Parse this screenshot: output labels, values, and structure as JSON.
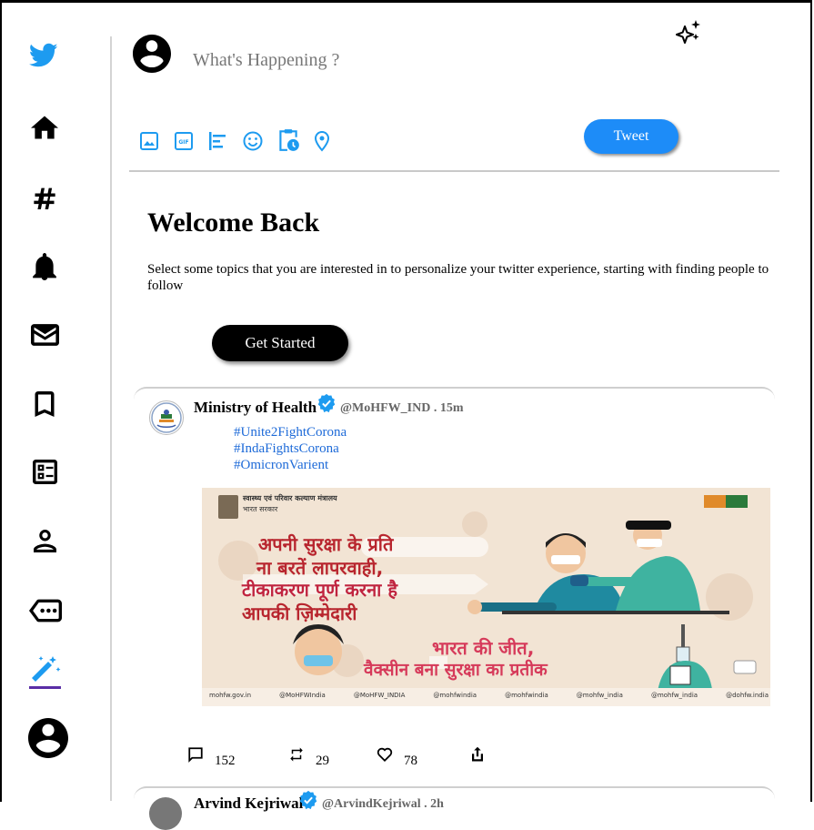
{
  "compose": {
    "placeholder": "What's Happening ?",
    "tweet_label": "Tweet"
  },
  "welcome": {
    "title": "Welcome Back",
    "text": "Select some topics that you are interested in to personalize your twitter experience, starting with finding people to follow",
    "button_label": "Get Started"
  },
  "posts": [
    {
      "name": "Ministry of Health",
      "handle": "@MoHFW_IND . 15m",
      "verified": true,
      "hashtags": [
        "#Unite2FightCorona",
        "#IndaFightsCorona",
        "#OmicronVarient"
      ],
      "image": {
        "header_line1": "स्वास्थ्य एवं परिवार कल्याण मंत्रालय",
        "header_line2": "भारत सरकार",
        "line1": "अपनी सुरक्षा के प्रति",
        "line2": "ना बरतें लापरवाही,",
        "line3": "टीकाकरण पूर्ण करना है",
        "line4": "आपकी ज़िम्मेदारी",
        "line5": "भारत की जीत,",
        "line6": "वैक्सीन बना सुरक्षा का प्रतीक",
        "footer": [
          "mohfw.gov.in",
          "@MoHFWIndia",
          "@MoHFW_INDIA",
          "@mohfwindia",
          "@mohfwindia",
          "@mohfw_india",
          "@mohfw_india",
          "@dohfw.india"
        ]
      },
      "stats": {
        "replies": "152",
        "retweets": "29",
        "likes": "78"
      }
    },
    {
      "name": "Arvind Kejriwal",
      "handle": "@ArvindKejriwal . 2h",
      "verified": true
    }
  ],
  "icons": {
    "sidebar": [
      "twitter-logo-icon",
      "home-icon",
      "hashtag-icon",
      "bell-icon",
      "mail-icon",
      "bookmark-icon",
      "list-icon",
      "person-icon",
      "more-icon",
      "magic-wand-icon",
      "account-circle-icon"
    ],
    "compose_tools": [
      "image-icon",
      "gif-icon",
      "poll-icon",
      "emoji-icon",
      "schedule-icon",
      "location-icon"
    ]
  },
  "colors": {
    "brand": "#1d9bf0",
    "tweet_button": "#1d8cf8",
    "link": "#1d6ad8",
    "active_underline": "#5a2ea6"
  }
}
